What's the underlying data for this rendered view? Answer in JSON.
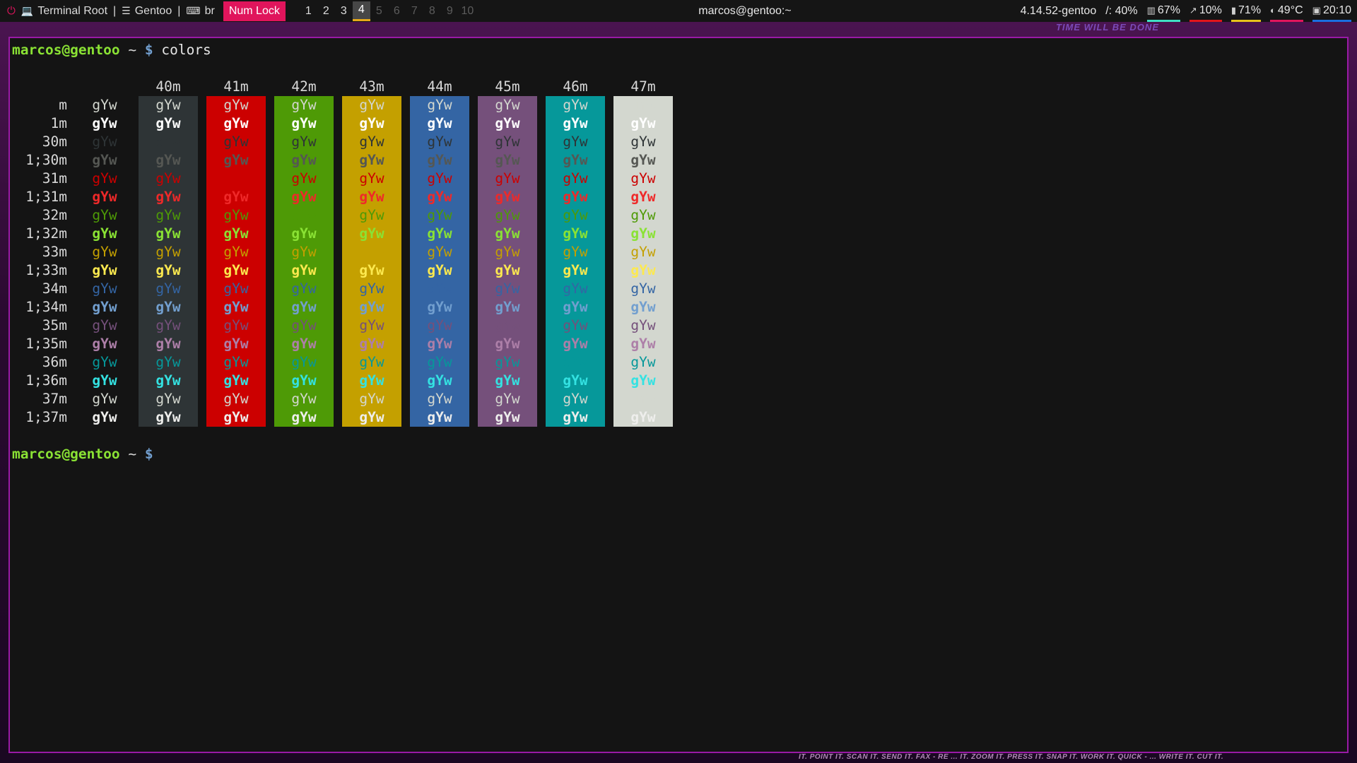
{
  "topbar": {
    "power_icon": "power-icon",
    "window_icon": "laptop-icon",
    "window_label": "Terminal Root",
    "separator": "|",
    "distro_icon": "list-icon",
    "distro_label": "Gentoo",
    "keyboard_icon": "keyboard-icon",
    "keyboard_layout": "br",
    "numlock": "Num Lock",
    "workspaces": [
      "1",
      "2",
      "3",
      "4",
      "5",
      "6",
      "7",
      "8",
      "9",
      "10"
    ],
    "active_workspace": "4",
    "window_title": "marcos@gentoo:~",
    "kernel": "4.14.52-gentoo",
    "disk": "/: 40%",
    "cpu": "67%",
    "mem": "10%",
    "battery": "71%",
    "temp": "49°C",
    "clock": "20:10",
    "colors": {
      "numlock_bg": "#e0155c",
      "active_ws_underline": "#e6a91a",
      "cpu_bar": "#3fe0c4",
      "mem_bar": "#e0151a",
      "battery_bar": "#e6c31a",
      "temp_bar": "#e0155c",
      "clock_bar": "#1a6ee0"
    }
  },
  "wallpaper": {
    "top_text": "TIME WILL BE DONE",
    "bottom_text": "IT. POINT IT. SCAN IT. SEND IT. FAX - RE ... IT. ZOOM IT. PRESS IT. SNAP IT. WORK IT. QUICK - ... WRITE IT. CUT IT."
  },
  "terminal": {
    "prompt_user": "marcos@gentoo",
    "prompt_path": " ~ ",
    "prompt_symbol": "$",
    "command": " colors",
    "sample_text": "gYw",
    "bg_headers": [
      "40m",
      "41m",
      "42m",
      "43m",
      "44m",
      "45m",
      "46m",
      "47m"
    ],
    "row_labels": [
      "m",
      "1m",
      "30m",
      "1;30m",
      "31m",
      "1;31m",
      "32m",
      "1;32m",
      "33m",
      "1;33m",
      "34m",
      "1;34m",
      "35m",
      "1;35m",
      "36m",
      "1;36m",
      "37m",
      "1;37m"
    ],
    "palette": {
      "bg": [
        "#2e3436",
        "#cc0000",
        "#4e9a06",
        "#c4a000",
        "#3465a4",
        "#75507b",
        "#06989a",
        "#d3d7cf"
      ],
      "fg_normal": {
        "m": "#d3d7cf",
        "30m": "#2e3436",
        "31m": "#cc0000",
        "32m": "#4e9a06",
        "33m": "#c4a000",
        "34m": "#3465a4",
        "35m": "#75507b",
        "36m": "#06989a",
        "37m": "#d3d7cf"
      },
      "fg_bold": {
        "1m": "#ffffff",
        "1;30m": "#555753",
        "1;31m": "#ef2929",
        "1;32m": "#8ae234",
        "1;33m": "#fce94f",
        "1;34m": "#729fcf",
        "1;35m": "#ad7fa8",
        "1;36m": "#34e2e2",
        "1;37m": "#eeeeec"
      }
    }
  }
}
